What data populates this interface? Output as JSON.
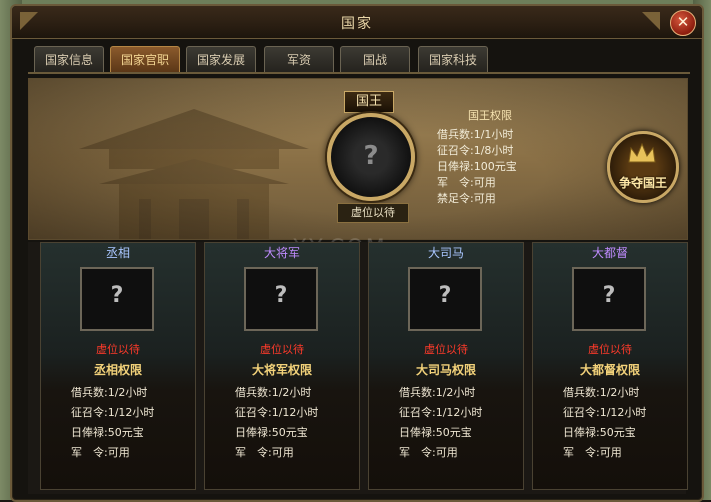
{
  "window": {
    "title": "国家",
    "close_label": "✕"
  },
  "tabs": [
    {
      "label": "国家信息",
      "active": false
    },
    {
      "label": "国家官职",
      "active": true
    },
    {
      "label": "国家发展",
      "active": false
    },
    {
      "label": "军资",
      "active": false
    },
    {
      "label": "国战",
      "active": false
    },
    {
      "label": "国家科技",
      "active": false
    }
  ],
  "king": {
    "title": "国王",
    "portrait_placeholder": "?",
    "status": "虚位以待",
    "rights_title": "国王权限",
    "rights": [
      "借兵数:1/1小时",
      "征召令:1/8小时",
      "日俸禄:100元宝",
      "军　令:可用",
      "禁足令:可用"
    ],
    "contest_button": "争夺国王"
  },
  "officers": [
    {
      "title": "丞相",
      "title_color": "#a9c6ff",
      "placeholder": "?",
      "status": "虚位以待",
      "rights_title": "丞相权限",
      "rights": [
        "借兵数:1/2小时",
        "征召令:1/12小时",
        "日俸禄:50元宝",
        "军　令:可用"
      ]
    },
    {
      "title": "大将军",
      "title_color": "#c08cff",
      "placeholder": "?",
      "status": "虚位以待",
      "rights_title": "大将军权限",
      "rights": [
        "借兵数:1/2小时",
        "征召令:1/12小时",
        "日俸禄:50元宝",
        "军　令:可用"
      ]
    },
    {
      "title": "大司马",
      "title_color": "#a9c6ff",
      "placeholder": "?",
      "status": "虚位以待",
      "rights_title": "大司马权限",
      "rights": [
        "借兵数:1/2小时",
        "征召令:1/12小时",
        "日俸禄:50元宝",
        "军　令:可用"
      ]
    },
    {
      "title": "大都督",
      "title_color": "#c08cff",
      "placeholder": "?",
      "status": "虚位以待",
      "rights_title": "大都督权限",
      "rights": [
        "借兵数:1/2小时",
        "征召令:1/12小时",
        "日俸禄:50元宝",
        "军　令:可用"
      ]
    }
  ],
  "watermark": "XY.COM"
}
